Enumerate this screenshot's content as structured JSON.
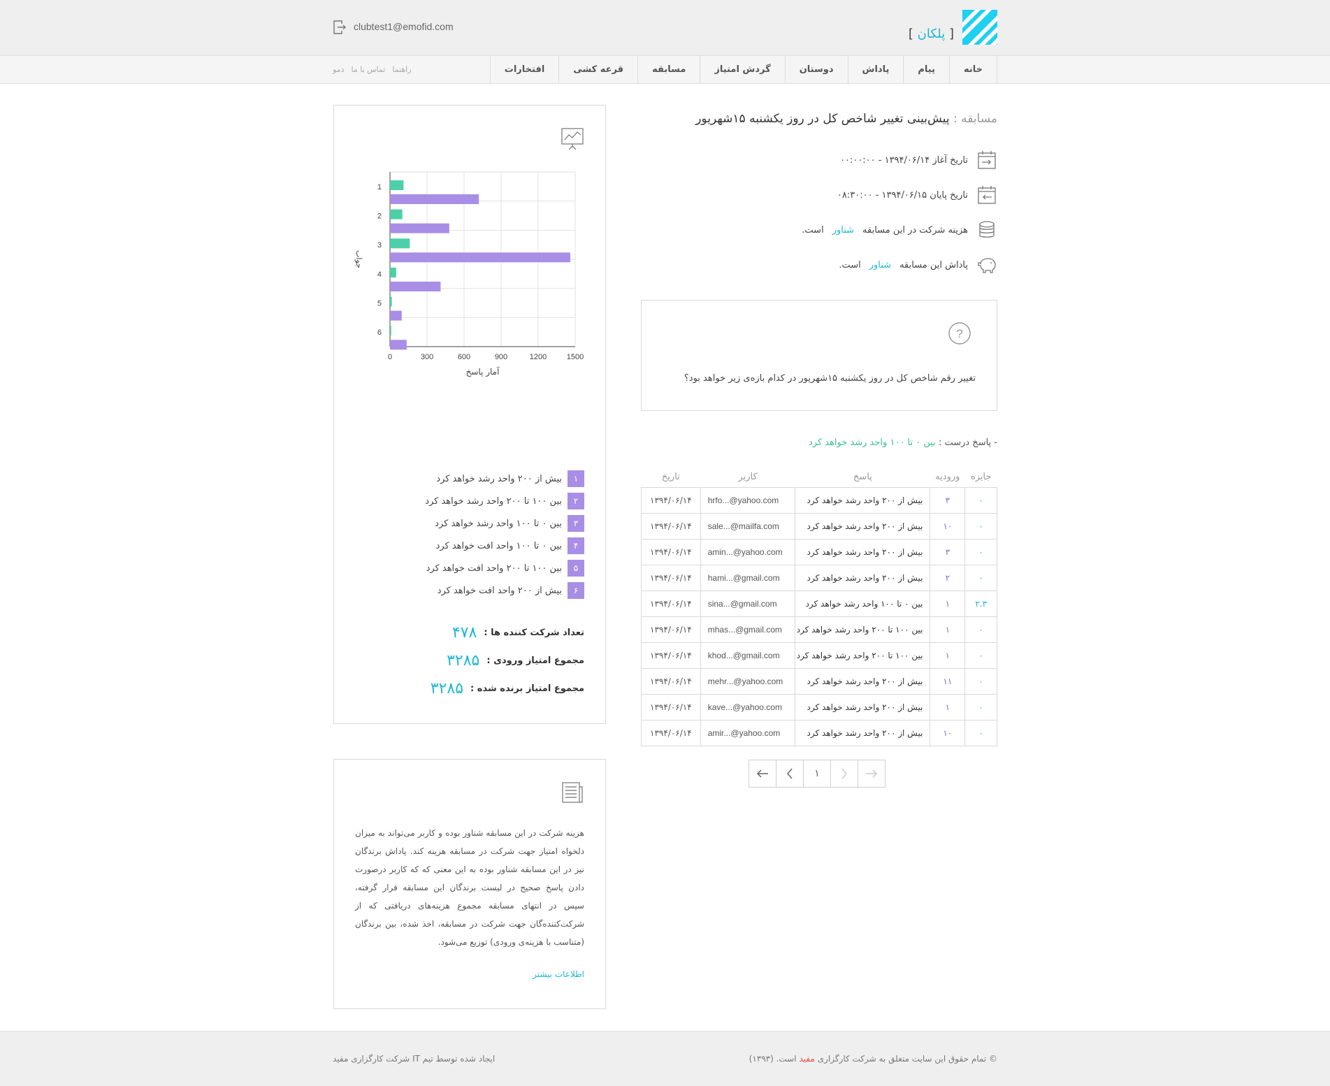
{
  "header": {
    "logo_text": "پلکان",
    "user_email": "clubtest1@emofid.com"
  },
  "nav": {
    "main": [
      "خانه",
      "پیام",
      "پاداش",
      "دوستان",
      "گردش امتیاز",
      "مسابقه",
      "قرعه کشی",
      "افتخارات"
    ],
    "aux": [
      "راهنما",
      "تماس با ما",
      "دمو"
    ]
  },
  "contest": {
    "title_label": "مسابقه :",
    "title": "پیش‌بینی تغییر شاخص کل در روز یکشنبه ۱۵شهریور",
    "start": "تاریخ آغاز ۱۳۹۴/۰۶/۱۴ - ۰۰:۰۰:۰۰",
    "end": "تاریخ پایان ۱۳۹۴/۰۶/۱۵ - ۰۸:۳۰:۰۰",
    "cost_prefix": "هزینه شرکت در این مسابقه",
    "cost_value": "شناور",
    "cost_suffix": "است.",
    "prize_prefix": "پاداش این مسابقه",
    "prize_value": "شناور",
    "prize_suffix": "است."
  },
  "question": {
    "text": "تغییر رقم شاخص کل در روز یکشنبه ۱۵شهریور در کدام بازه‌ی زیر خواهد بود؟"
  },
  "correct": {
    "label": "- پاسخ درست :",
    "value": "بین ۰ تا ۱۰۰ واحد رشد خواهد کرد"
  },
  "table": {
    "headers": [
      "جایزه",
      "ورودیه",
      "پاسخ",
      "کاربر",
      "تاریخ"
    ],
    "rows": [
      {
        "prize": "۰",
        "entry": "۳",
        "answer": "بیش از ۲۰۰ واحد رشد خواهد کرد",
        "user": "hrfo...@yahoo.com",
        "date": "۱۳۹۴/۰۶/۱۴"
      },
      {
        "prize": "۰",
        "entry": "۱۰",
        "answer": "بیش از ۲۰۰ واحد رشد خواهد کرد",
        "user": "sale...@mailfa.com",
        "date": "۱۳۹۴/۰۶/۱۴"
      },
      {
        "prize": "۰",
        "entry": "۳",
        "answer": "بیش از ۲۰۰ واحد رشد خواهد کرد",
        "user": "amin...@yahoo.com",
        "date": "۱۳۹۴/۰۶/۱۴"
      },
      {
        "prize": "۰",
        "entry": "۲",
        "answer": "بیش از ۲۰۰ واحد رشد خواهد کرد",
        "user": "hami...@gmail.com",
        "date": "۱۳۹۴/۰۶/۱۴"
      },
      {
        "prize": "۲.۳",
        "entry": "۱",
        "answer": "بین ۰ تا ۱۰۰ واحد رشد خواهد کرد",
        "user": "sina...@gmail.com",
        "date": "۱۳۹۴/۰۶/۱۴"
      },
      {
        "prize": "۰",
        "entry": "۱",
        "answer": "بین ۱۰۰ تا ۲۰۰ واحد رشد خواهد کرد",
        "user": "mhas...@gmail.com",
        "date": "۱۳۹۴/۰۶/۱۴"
      },
      {
        "prize": "۰",
        "entry": "۱",
        "answer": "بین ۱۰۰ تا ۲۰۰ واحد رشد خواهد کرد",
        "user": "khod...@gmail.com",
        "date": "۱۳۹۴/۰۶/۱۴"
      },
      {
        "prize": "۰",
        "entry": "۱۱",
        "answer": "بیش از ۲۰۰ واحد رشد خواهد کرد",
        "user": "mehr...@yahoo.com",
        "date": "۱۳۹۴/۰۶/۱۴"
      },
      {
        "prize": "۰",
        "entry": "۱",
        "answer": "بیش از ۲۰۰ واحد رشد خواهد کرد",
        "user": "kave...@yahoo.com",
        "date": "۱۳۹۴/۰۶/۱۴"
      },
      {
        "prize": "۰",
        "entry": "۱۰",
        "answer": "بیش از ۲۰۰ واحد رشد خواهد کرد",
        "user": "amir...@yahoo.com",
        "date": "۱۳۹۴/۰۶/۱۴"
      }
    ]
  },
  "pagination": {
    "current": "۱"
  },
  "chart_data": {
    "type": "bar",
    "orientation": "horizontal",
    "categories": [
      "1",
      "2",
      "3",
      "4",
      "5",
      "6"
    ],
    "series": [
      {
        "values": [
          110,
          100,
          160,
          50,
          15,
          10
        ],
        "color": "#4dd0a8"
      },
      {
        "values": [
          720,
          480,
          1460,
          410,
          95,
          135
        ],
        "color": "#a98ee6"
      }
    ],
    "xlabel": "آمار پاسخ",
    "ylabel": "جواب",
    "xlim": [
      0,
      1500
    ],
    "xticks": [
      0,
      300,
      600,
      900,
      1200,
      1500
    ],
    "grid": true
  },
  "legend": [
    {
      "num": "۱",
      "text": "بیش از ۲۰۰ واحد رشد خواهد کرد"
    },
    {
      "num": "۲",
      "text": "بین ۱۰۰ تا ۲۰۰ واحد رشد خواهد کرد"
    },
    {
      "num": "۳",
      "text": "بین ۰ تا ۱۰۰ واحد رشد خواهد کرد"
    },
    {
      "num": "۴",
      "text": "بین ۰ تا ۱۰۰ واحد افت خواهد کرد"
    },
    {
      "num": "۵",
      "text": "بین ۱۰۰ تا ۲۰۰ واحد افت خواهد کرد"
    },
    {
      "num": "۶",
      "text": "بیش از ۲۰۰ واحد افت خواهد کرد"
    }
  ],
  "stats": {
    "participants_label": "تعداد شرکت کننده ها :",
    "participants": "۴۷۸",
    "entry_sum_label": "مجموع امتیاز ورودی :",
    "entry_sum": "۳۲۸۵",
    "won_sum_label": "مجموع امتیاز برنده شده :",
    "won_sum": "۳۲۸۵"
  },
  "info": {
    "text": "هزینه شرکت در این مسابقه شناور بوده و کاربر می‌تواند به میزان دلخواه امتیاز جهت شرکت در مسابقه هزینه کند. پاداش برندگان نیز در این مسابقه شناور بوده به این معنی که که کاربر درصورت دادن پاسخ صحیح در لیست برندگان این مسابقه قرار گرفته، سپس در انتهای مسابقه مجموع هزینه‌های دریافتی که از شرکت‌کننده‌گان جهت شرکت در مسابقه، اخذ شده، بین برندگان (متناسب با هزینه‌ی ورودی) توزیع می‌شود.",
    "more": "اطلاعات بیشتر"
  },
  "footer": {
    "rights_prefix": "© تمام حقوق این سایت متعلق به شرکت کارگزاری",
    "brand": "مفید",
    "rights_suffix": "است. (۱۳۹۳)",
    "credit": "ایجاد شده توسط تیم IT شرکت کارگزاری مفید"
  }
}
